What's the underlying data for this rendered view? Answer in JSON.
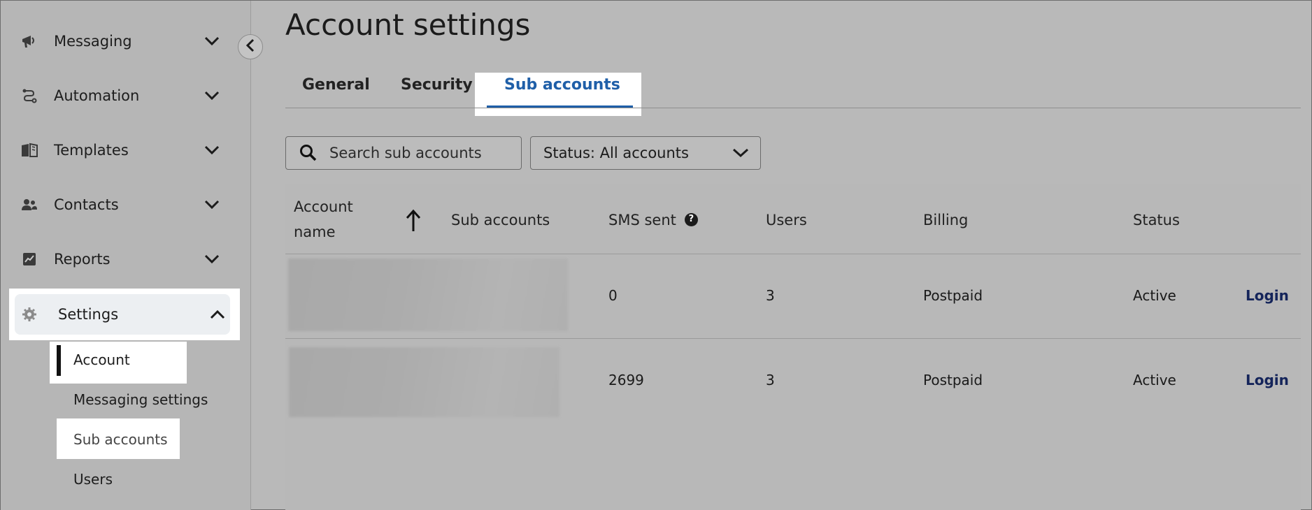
{
  "sidebar": {
    "items": [
      {
        "label": "Messaging",
        "icon": "megaphone-icon"
      },
      {
        "label": "Automation",
        "icon": "workflow-icon"
      },
      {
        "label": "Templates",
        "icon": "book-icon"
      },
      {
        "label": "Contacts",
        "icon": "people-icon"
      },
      {
        "label": "Reports",
        "icon": "chart-icon"
      },
      {
        "label": "Settings",
        "icon": "gear-icon"
      }
    ],
    "settings_sub": {
      "account": "Account",
      "messaging_settings": "Messaging settings",
      "sub_accounts": "Sub accounts",
      "users": "Users"
    }
  },
  "main": {
    "title": "Account settings",
    "tabs": [
      {
        "label": "General"
      },
      {
        "label": "Security"
      },
      {
        "label": "Sub accounts",
        "active": true
      }
    ],
    "search": {
      "placeholder": "Search sub accounts",
      "value": ""
    },
    "status_filter": {
      "label": "Status: All accounts"
    },
    "table": {
      "headers": {
        "account_name_line1": "Account",
        "account_name_line2": "name",
        "sub_accounts": "Sub accounts",
        "sms_sent": "SMS sent",
        "sms_help": "?",
        "users": "Users",
        "billing": "Billing",
        "status": "Status"
      },
      "rows": [
        {
          "sms_sent": "0",
          "users": "3",
          "billing": "Postpaid",
          "status": "Active",
          "action": "Login"
        },
        {
          "sms_sent": "2699",
          "users": "3",
          "billing": "Postpaid",
          "status": "Active",
          "action": "Login"
        }
      ]
    }
  },
  "colors": {
    "accent": "#1f5fa8",
    "link": "#14245a",
    "overlay": "#b9b9b9"
  }
}
